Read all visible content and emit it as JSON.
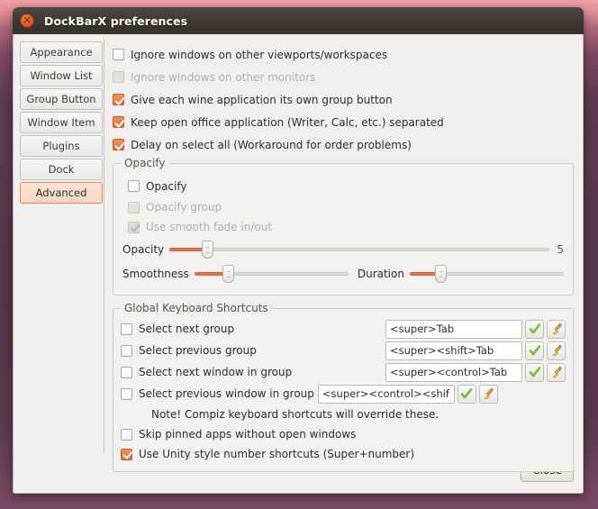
{
  "window": {
    "title": "DockBarX preferences",
    "close_icon": "close-icon"
  },
  "sidebar": {
    "items": [
      {
        "label": "Appearance",
        "selected": false
      },
      {
        "label": "Window List",
        "selected": false
      },
      {
        "label": "Group Button",
        "selected": false
      },
      {
        "label": "Window Item",
        "selected": false
      },
      {
        "label": "Plugins",
        "selected": false
      },
      {
        "label": "Dock",
        "selected": false
      },
      {
        "label": "Advanced",
        "selected": true
      }
    ]
  },
  "main": {
    "top_options": [
      {
        "label": "Ignore windows on other viewports/workspaces",
        "checked": false,
        "enabled": true
      },
      {
        "label": "Ignore windows on other monitors",
        "checked": false,
        "enabled": false
      },
      {
        "label": "Give each wine application its own group button",
        "checked": true,
        "enabled": true
      },
      {
        "label": "Keep open office application (Writer, Calc, etc.) separated",
        "checked": true,
        "enabled": true
      },
      {
        "label": "Delay on select all (Workaround for order problems)",
        "checked": true,
        "enabled": true
      }
    ],
    "opacify": {
      "title": "Opacify",
      "options": [
        {
          "label": "Opacify",
          "checked": false,
          "enabled": true
        },
        {
          "label": "Opacify group",
          "checked": false,
          "enabled": false
        },
        {
          "label": "Use smooth fade in/out",
          "checked": true,
          "enabled": false
        }
      ],
      "opacity": {
        "label": "Opacity",
        "value": "5",
        "percent": 10
      },
      "smoothness": {
        "label": "Smoothness",
        "percent": 22
      },
      "duration": {
        "label": "Duration",
        "percent": 20
      }
    },
    "shortcuts": {
      "title": "Global Keyboard Shortcuts",
      "rows": [
        {
          "label": "Select next group",
          "checked": false,
          "value": "<super>Tab"
        },
        {
          "label": "Select previous group",
          "checked": false,
          "value": "<super><shift>Tab"
        },
        {
          "label": "Select next window in group",
          "checked": false,
          "value": "<super><control>Tab"
        },
        {
          "label": "Select previous window in group",
          "checked": false,
          "value": "<super><control><shif"
        }
      ],
      "apply_icon": "checkmark-icon",
      "clear_icon": "broom-icon",
      "note": "Note! Compiz keyboard shortcuts will override these.",
      "extra_options": [
        {
          "label": "Skip pinned apps without open windows",
          "checked": false,
          "enabled": true
        },
        {
          "label": "Use Unity style number shortcuts (Super+number)",
          "checked": true,
          "enabled": true
        }
      ]
    }
  },
  "footer": {
    "close_label": "Close"
  },
  "colors": {
    "accent": "#e2713a",
    "titlebar": "#3b3835",
    "selected_tab_border": "#e8894f",
    "slider_fill": "#e8754a"
  }
}
